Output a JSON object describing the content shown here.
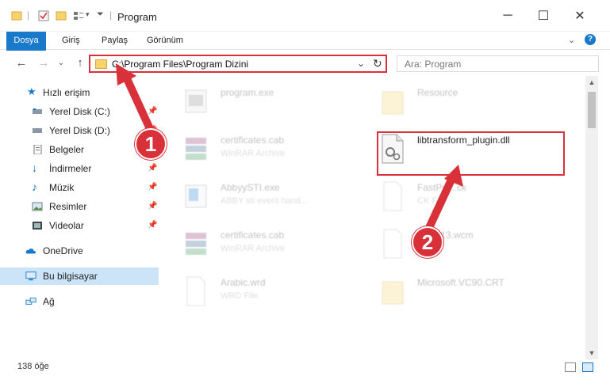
{
  "window": {
    "title": "Program"
  },
  "ribbon": {
    "tabs": [
      "Dosya",
      "Giriş",
      "Paylaş",
      "Görünüm"
    ]
  },
  "address": {
    "path": "C:\\Program Files\\Program Dizini"
  },
  "search": {
    "placeholder": "Ara: Program"
  },
  "nav": {
    "items": [
      {
        "label": "Hızlı erişim",
        "icon": "star-icon"
      },
      {
        "label": "Yerel Disk (C:)",
        "icon": "drive-icon",
        "pinned": true
      },
      {
        "label": "Yerel Disk (D:)",
        "icon": "drive-icon",
        "pinned": true
      },
      {
        "label": "Belgeler",
        "icon": "documents-icon",
        "pinned": true
      },
      {
        "label": "İndirmeler",
        "icon": "download-icon",
        "pinned": true
      },
      {
        "label": "Müzik",
        "icon": "music-icon",
        "pinned": true
      },
      {
        "label": "Resimler",
        "icon": "pictures-icon",
        "pinned": true
      },
      {
        "label": "Videolar",
        "icon": "video-icon",
        "pinned": true
      },
      {
        "label": "OneDrive",
        "icon": "cloud-icon"
      },
      {
        "label": "Bu bilgisayar",
        "icon": "computer-icon",
        "selected": true
      },
      {
        "label": "Ağ",
        "icon": "network-icon"
      }
    ]
  },
  "files": [
    {
      "name": "program.exe",
      "type": "",
      "kind": "exe"
    },
    {
      "name": "Resource",
      "type": "",
      "kind": "folder"
    },
    {
      "name": "certificates.cab",
      "type": "WinRAR Archive",
      "kind": "archive"
    },
    {
      "name": "libtransform_plugin.dll",
      "type": "",
      "kind": "dll",
      "highlighted": true
    },
    {
      "name": "AbbyySTI.exe",
      "type": "ABBY sti event hand...",
      "kind": "exe"
    },
    {
      "name": "FastPic...ck",
      "type": "CK File",
      "kind": "doc"
    },
    {
      "name": "certificates.cab",
      "type": "WinRAR Archive",
      "kind": "archive"
    },
    {
      "name": "...WP13.wcm",
      "type": "File",
      "kind": "doc"
    },
    {
      "name": "Arabic.wrd",
      "type": "WRD File",
      "kind": "doc"
    },
    {
      "name": "Microsoft.VC90.CRT",
      "type": "",
      "kind": "folder"
    }
  ],
  "status": {
    "count": "138 öğe"
  },
  "annotations": {
    "step1": "1",
    "step2": "2"
  },
  "colors": {
    "accent": "#1979ca",
    "highlight": "#d9313a",
    "selection": "#cce4f7"
  }
}
